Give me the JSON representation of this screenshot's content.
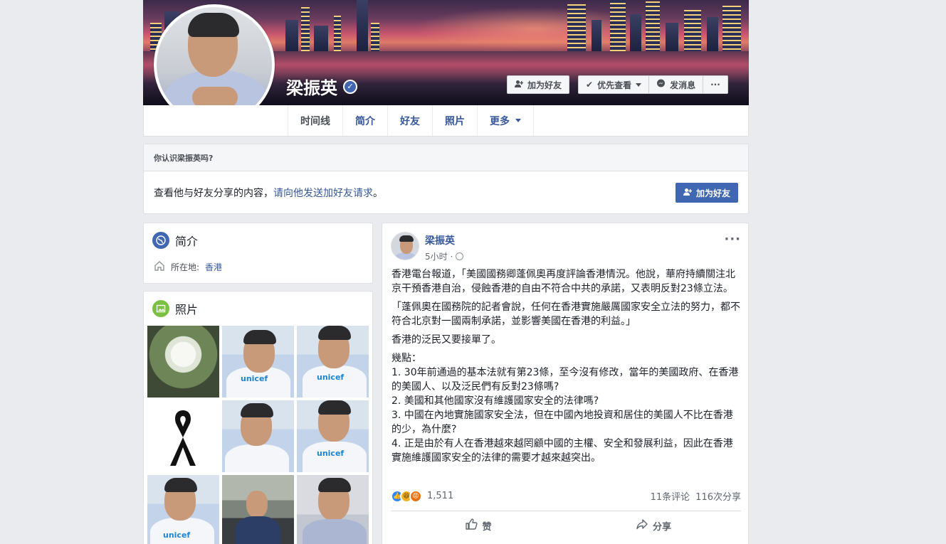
{
  "profile": {
    "name": "梁振英",
    "verified": true
  },
  "cover_actions": {
    "add_friend": "加为好友",
    "see_first": "优先查看",
    "message": "发消息",
    "more": "···"
  },
  "tabs": [
    {
      "label": "时间线",
      "active": true
    },
    {
      "label": "简介"
    },
    {
      "label": "好友"
    },
    {
      "label": "照片"
    },
    {
      "label": "更多"
    }
  ],
  "know_box": {
    "title": "你认识梁振英吗?",
    "text": "查看他与好友分享的内容，",
    "link": "请向他发送加好友请求",
    "end": "。",
    "button": "加为好友"
  },
  "intro": {
    "title": "简介",
    "location_label": "所在地:",
    "location_value": "香港"
  },
  "photos": {
    "title": "照片",
    "unicef_label": "unicef"
  },
  "post": {
    "author": "梁振英",
    "time": "5小时",
    "separator": "·",
    "more": "···",
    "paragraphs": [
      "香港電台報道，「美國國務卿蓬佩奧再度評論香港情況。他說，華府持續關注北京干預香港自治，侵蝕香港的自由不符合中共的承諾，又表明反對23條立法。",
      "「蓬佩奧在國務院的記者會說，任何在香港實施嚴厲國家安全立法的努力，都不符合北京對一國兩制承諾，並影響美國在香港的利益。」",
      "香港的泛民又要接單了。"
    ],
    "points": [
      "幾點：",
      "1. 30年前通過的基本法就有第23條，至今沒有修改，當年的美國政府、在香港的美國人、以及泛民們有反對23條嗎?",
      "2. 美國和其他國家沒有維護國家安全的法律嗎?",
      "3. 中國在內地實施國家安全法，但在中國內地投資和居住的美國人不比在香港的少，為什麼?",
      "4. 正是由於有人在香港越來越罔顧中國的主權、安全和發展利益，因此在香港實施維護國家安全的法律的需要才越來越突出。"
    ],
    "reaction_count": "1,511",
    "comments": "11条评论",
    "shares": "116次分享",
    "like_label": "赞",
    "share_label": "分享"
  },
  "colors": {
    "brand": "#4267b2",
    "link": "#365899",
    "background": "#e9ebee"
  }
}
